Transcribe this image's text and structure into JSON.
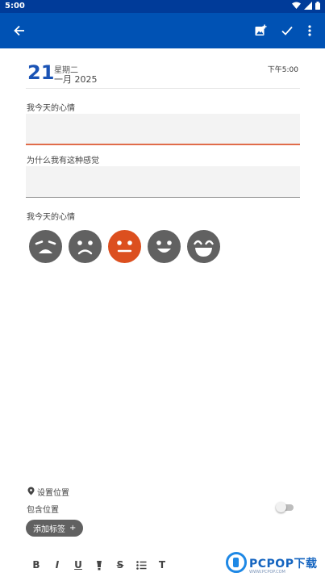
{
  "status_bar": {
    "time": "5:00",
    "icons": [
      "wifi-icon",
      "signal-icon",
      "battery-icon"
    ]
  },
  "app_bar": {
    "background": "#0052b4",
    "icons": [
      "back-arrow-icon",
      "add-photo-icon",
      "check-icon",
      "more-vert-icon"
    ]
  },
  "entry": {
    "day": "21",
    "weekday": "星期二",
    "month_year": "一月 2025",
    "time": "下午5:00"
  },
  "fields": {
    "mood_today_label": "我今天的心情",
    "mood_today_value": "",
    "why_label": "为什么我有这种感觉",
    "why_value": "",
    "mood_picker_label": "我今天的心情"
  },
  "moods": [
    {
      "name": "very-sad",
      "color": "#616161",
      "selected": false
    },
    {
      "name": "sad",
      "color": "#616161",
      "selected": false
    },
    {
      "name": "neutral",
      "color": "#dc4f1f",
      "selected": true
    },
    {
      "name": "happy",
      "color": "#616161",
      "selected": false
    },
    {
      "name": "very-happy",
      "color": "#616161",
      "selected": false
    }
  ],
  "location": {
    "set_label": "设置位置",
    "include_label": "包含位置",
    "include_enabled": false
  },
  "tags": {
    "add_label": "添加标签",
    "add_symbol": "+"
  },
  "format_toolbar": {
    "bold": "B",
    "italic": "I",
    "underline": "U",
    "strike": "S",
    "text_style": "T",
    "icons": [
      "bold-icon",
      "italic-icon",
      "underline-icon",
      "highlight-icon",
      "strikethrough-icon",
      "bullet-list-icon",
      "text-format-icon"
    ]
  },
  "watermark": {
    "brand": "PCPOP下载",
    "sub": "WWW.PCPOP.COM"
  },
  "colors": {
    "accent": "#0052b4",
    "status_bar": "#003b99",
    "selected_mood": "#dc4f1f",
    "field_active_underline": "#e06c4a"
  }
}
